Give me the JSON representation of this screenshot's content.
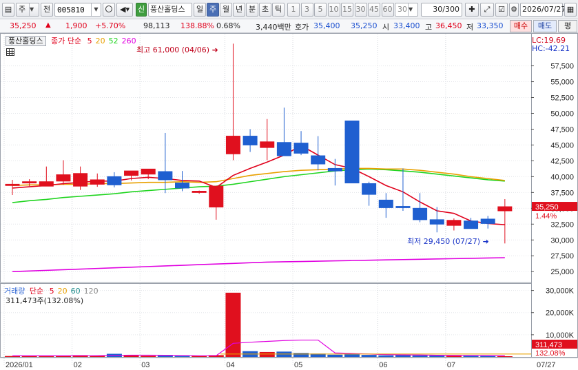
{
  "toolbar": {
    "menu_icon": "window-menu-icon",
    "type_label": "주",
    "prev_label": "전",
    "stock_code": "005810",
    "search_icon": "search-icon",
    "speaker_icon": "speaker-icon",
    "new_badge": "신",
    "stock_name": "풍산홀딩스",
    "period_tabs": [
      "일",
      "주",
      "월",
      "년",
      "분",
      "초",
      "틱"
    ],
    "selected_period": "주",
    "interval_buttons": [
      "1",
      "3",
      "5",
      "10",
      "15",
      "30",
      "45",
      "60"
    ],
    "interval_value": "30",
    "count_value": "30",
    "count_total": "/300",
    "date_value": "2026/07/27"
  },
  "quote": {
    "price": "35,250",
    "change_arrow": "▲",
    "change": "1,900",
    "change_pct": "+5.70%",
    "volume": "98,113",
    "volume_ratio": "138.88%",
    "turnover": "0.68%",
    "amount": "3,440백만",
    "ask_label": "호가",
    "ask": "35,400",
    "bid": "35,250",
    "open_label": "시",
    "open": "33,400",
    "high_label": "고",
    "high": "36,450",
    "low_label": "저",
    "low": "33,350",
    "buy_label": "매수",
    "sell_label": "매도",
    "eval_label": "평"
  },
  "price_panel": {
    "title": "풍산홀딩스",
    "indicator": "종가 단순",
    "ma_periods": [
      "5",
      "20",
      "52",
      "260"
    ],
    "ma_colors": [
      "#e0001b",
      "#e8a000",
      "#1fd41f",
      "#e000e0"
    ],
    "high_note": "최고 61,000 (04/06)",
    "low_note": "최저 29,450 (07/27)",
    "lc_label": "LC:19.69",
    "hc_label": "HC:-42.21",
    "last_price": "35,250",
    "last_pct": "1.44%",
    "y_ticks": [
      "57,500",
      "55,000",
      "52,500",
      "50,000",
      "47,500",
      "45,000",
      "42,500",
      "40,000",
      "37,500",
      "35,000",
      "32,500",
      "30,000",
      "27,500",
      "25,000"
    ]
  },
  "volume_panel": {
    "title": "거래량",
    "indicator": "단순",
    "ma_periods": [
      "5",
      "20",
      "60",
      "120"
    ],
    "current": "311,473주(132.08%)",
    "last_volume": "311,473",
    "last_pct": "132.08%",
    "y_ticks": [
      "30,000K",
      "20,000K",
      "10,000K"
    ]
  },
  "x_axis": {
    "labels": [
      "2026/01",
      "02",
      "03",
      "04",
      "05",
      "06",
      "07"
    ],
    "end_label": "07/27"
  },
  "chart_data": {
    "type": "candlestick",
    "x": [
      "01/05",
      "01/12",
      "01/19",
      "01/26",
      "02/02",
      "02/09",
      "02/16",
      "02/23",
      "03/02",
      "03/09",
      "03/16",
      "03/23",
      "03/30",
      "04/06",
      "04/13",
      "04/20",
      "04/27",
      "05/04",
      "05/11",
      "05/18",
      "05/25",
      "06/01",
      "06/08",
      "06/15",
      "06/22",
      "06/29",
      "07/06",
      "07/13",
      "07/20",
      "07/27"
    ],
    "open": [
      38600,
      39000,
      38500,
      39300,
      38500,
      38800,
      40000,
      40200,
      40400,
      40800,
      39000,
      37500,
      35200,
      43600,
      46400,
      44600,
      45400,
      45300,
      43300,
      41300,
      48800,
      38900,
      36300,
      35300,
      35000,
      33200,
      32300,
      33000,
      33300,
      34600
    ],
    "high": [
      39500,
      39600,
      41600,
      42600,
      41600,
      40500,
      40700,
      40800,
      41200,
      46900,
      40900,
      37800,
      37800,
      61000,
      47500,
      49100,
      50900,
      47200,
      46400,
      42800,
      48800,
      39200,
      37400,
      41300,
      37400,
      35200,
      33400,
      33500,
      33800,
      36450
    ],
    "low": [
      37100,
      38500,
      39000,
      38700,
      37900,
      38400,
      38300,
      39400,
      39600,
      37400,
      37700,
      37300,
      33200,
      42600,
      43900,
      42600,
      44000,
      43400,
      41000,
      38600,
      39000,
      35400,
      33500,
      34600,
      32800,
      31200,
      31500,
      32500,
      31800,
      29450
    ],
    "close": [
      38800,
      39200,
      39200,
      40300,
      40500,
      39500,
      38700,
      40900,
      41200,
      39500,
      38200,
      37700,
      38500,
      46400,
      45000,
      45500,
      43300,
      43700,
      42000,
      40900,
      39000,
      37200,
      35100,
      35100,
      33200,
      32500,
      33100,
      31800,
      32600,
      35250
    ],
    "ma5": [
      38200,
      38400,
      38600,
      38900,
      39100,
      39300,
      39300,
      39700,
      39900,
      39700,
      39400,
      39300,
      38300,
      40200,
      41300,
      42300,
      43400,
      44900,
      43400,
      41900,
      41300,
      40000,
      38600,
      37600,
      36000,
      34600,
      34200,
      33000,
      32600,
      32400
    ],
    "ma20": [
      38600,
      38700,
      38700,
      38800,
      38800,
      38900,
      38900,
      39000,
      39100,
      39100,
      39200,
      39100,
      39200,
      39700,
      40200,
      40500,
      40800,
      41000,
      41100,
      41200,
      41300,
      41300,
      41200,
      41200,
      41000,
      40700,
      40400,
      40000,
      39700,
      39400
    ],
    "ma52": [
      35900,
      36200,
      36400,
      36700,
      36900,
      37100,
      37300,
      37600,
      37800,
      38000,
      38200,
      38400,
      38500,
      38800,
      39200,
      39600,
      40000,
      40300,
      40600,
      40900,
      41100,
      41200,
      41100,
      40900,
      40700,
      40400,
      40100,
      39800,
      39500,
      39300
    ],
    "ma260": [
      25000,
      25100,
      25200,
      25300,
      25400,
      25500,
      25600,
      25700,
      25800,
      25900,
      26000,
      26100,
      26200,
      26300,
      26400,
      26500,
      26550,
      26600,
      26650,
      26700,
      26750,
      26800,
      26850,
      26900,
      26950,
      27000,
      27050,
      27100,
      27150,
      27200
    ],
    "volume": [
      400,
      500,
      300,
      600,
      800,
      500,
      1400,
      700,
      500,
      600,
      400,
      400,
      800,
      29000,
      2600,
      2200,
      2400,
      1800,
      1500,
      1000,
      1200,
      900,
      700,
      800,
      700,
      600,
      500,
      600,
      500,
      311
    ],
    "volume_ma5": [
      500,
      500,
      500,
      500,
      520,
      540,
      720,
      800,
      780,
      740,
      720,
      520,
      540,
      6120,
      6640,
      7000,
      7400,
      7600,
      7600,
      1780,
      1580,
      1280,
      1060,
      920,
      860,
      740,
      660,
      640,
      580,
      500
    ],
    "y_range": [
      23500,
      60500
    ],
    "volume_range": [
      0,
      30500
    ]
  }
}
